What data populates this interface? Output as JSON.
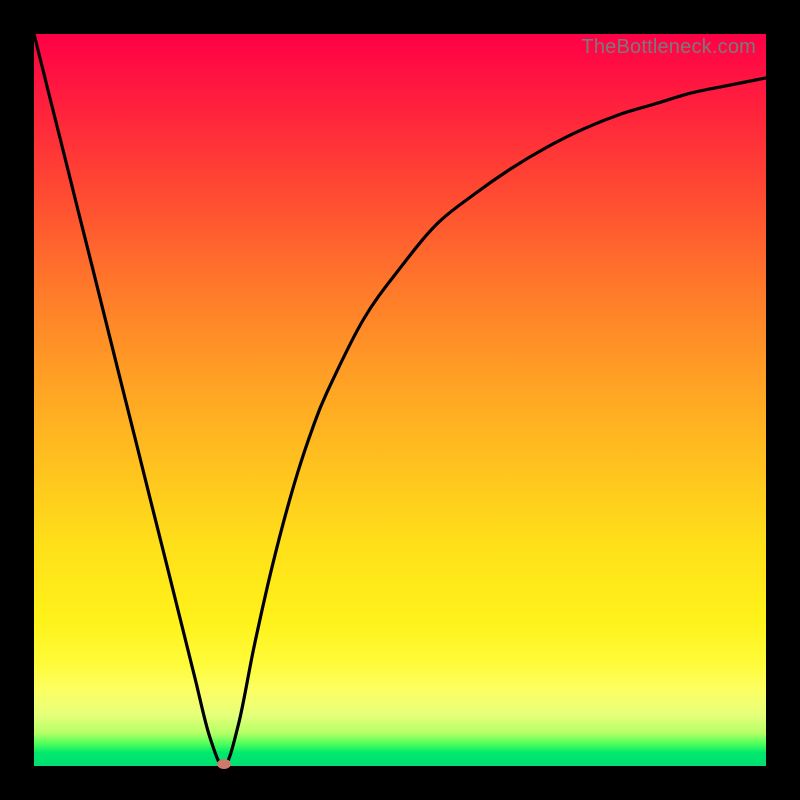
{
  "credit_text": "TheBottleneck.com",
  "colors": {
    "frame": "#000000",
    "curve_stroke": "#000000",
    "marker_fill": "#cc7a6b",
    "credit_text": "#7a7a7a"
  },
  "chart_data": {
    "type": "line",
    "title": "",
    "xlabel": "",
    "ylabel": "",
    "xlim": [
      0,
      100
    ],
    "ylim": [
      0,
      100
    ],
    "grid": false,
    "legend": false,
    "background_gradient": {
      "orientation": "vertical",
      "stops": [
        {
          "pos": 0.0,
          "color": "#ff0046"
        },
        {
          "pos": 0.35,
          "color": "#ff7a2a"
        },
        {
          "pos": 0.7,
          "color": "#ffe01a"
        },
        {
          "pos": 0.93,
          "color": "#e6ff7a"
        },
        {
          "pos": 1.0,
          "color": "#00e070"
        }
      ]
    },
    "x": [
      0,
      2,
      4,
      6,
      8,
      10,
      12,
      14,
      16,
      18,
      20,
      22,
      24,
      26,
      28,
      30,
      32,
      34,
      36,
      38,
      40,
      45,
      50,
      55,
      60,
      65,
      70,
      75,
      80,
      85,
      90,
      95,
      100
    ],
    "y": [
      100,
      92,
      84,
      76,
      68,
      60,
      52,
      44,
      36,
      28,
      20,
      12,
      4,
      0,
      6,
      16,
      25,
      33,
      40,
      46,
      51,
      61,
      68,
      74,
      78,
      81.5,
      84.5,
      87,
      89,
      90.5,
      92,
      93,
      94
    ],
    "marker": {
      "x": 26,
      "y": 0
    },
    "notes": "y expressed as percent of plot height from bottom; curve is a V-shape with minimum at x≈26, rising asymptotically to the right"
  }
}
